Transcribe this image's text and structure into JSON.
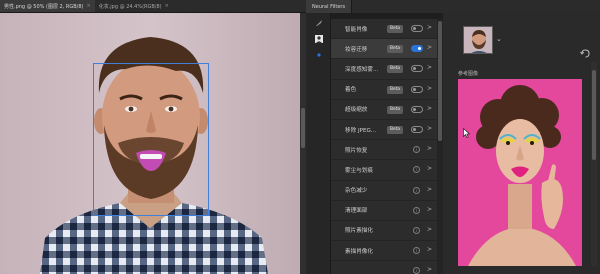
{
  "doc_tabs": [
    {
      "label": "男性.png @ 50% (图层 2, RGB/8)",
      "close": "×"
    },
    {
      "label": "化妆.jpg @ 24.4%(RGB/8)",
      "close": "×"
    }
  ],
  "panel": {
    "title": "Neural Filters"
  },
  "filters": [
    {
      "label": "智能肖像",
      "beta": "Beta",
      "control": "toggle",
      "on": false
    },
    {
      "label": "妆容迁移",
      "beta": "Beta",
      "control": "toggle",
      "on": true,
      "selected": true
    },
    {
      "label": "深度感知雾...",
      "beta": "Beta",
      "control": "toggle",
      "on": false
    },
    {
      "label": "着色",
      "beta": "Beta",
      "control": "toggle",
      "on": false
    },
    {
      "label": "超级缩放",
      "beta": "Beta",
      "control": "toggle",
      "on": false
    },
    {
      "label": "移除 JPEG...",
      "beta": "Beta",
      "control": "toggle",
      "on": false
    },
    {
      "label": "照片恢复",
      "control": "info"
    },
    {
      "label": "雾尘与划痕",
      "control": "info"
    },
    {
      "label": "杂色减少",
      "control": "info"
    },
    {
      "label": "清理面部",
      "control": "info"
    },
    {
      "label": "照片素描化",
      "control": "info"
    },
    {
      "label": "素描肖像化",
      "control": "info"
    },
    {
      "label": "",
      "control": "info"
    }
  ],
  "filter_chevron": ">",
  "settings": {
    "dropdown_chevron": "⌄",
    "reference_label": "参考图像"
  },
  "colors": {
    "accent_blue": "#2a74d8",
    "face_box": "#3d7fd9",
    "reference_bg": "#e4489d"
  }
}
